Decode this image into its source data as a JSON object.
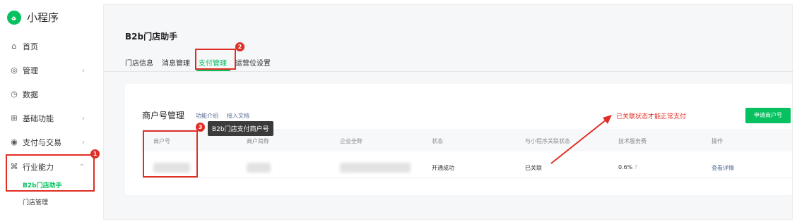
{
  "app": {
    "title": "小程序",
    "brand_color": "#07c160",
    "annotation_color": "#e02e24"
  },
  "sidebar": {
    "items": [
      {
        "label": "首页",
        "icon": "home-icon"
      },
      {
        "label": "管理",
        "icon": "settings-icon"
      },
      {
        "label": "数据",
        "icon": "clock-icon"
      },
      {
        "label": "基础功能",
        "icon": "grid-icon"
      },
      {
        "label": "支付与交易",
        "icon": "payment-icon"
      },
      {
        "label": "行业能力",
        "icon": "industry-icon"
      }
    ],
    "sub_items": [
      {
        "label": "B2b门店助手",
        "active": true
      },
      {
        "label": "门店管理",
        "active": false
      }
    ]
  },
  "main": {
    "page_title": "B2b门店助手",
    "tabs": [
      {
        "label": "门店信息"
      },
      {
        "label": "消息管理"
      },
      {
        "label": "支付管理",
        "active": true
      },
      {
        "label": "运营位设置"
      }
    ]
  },
  "card": {
    "title": "商户号管理",
    "link_intro": "功能介绍",
    "link_doc": "接入文档",
    "apply_button": "申请商户号",
    "columns": [
      "商户号",
      "商户简称",
      "企业全称",
      "状态",
      "与小程序关联状态",
      "技术服务费",
      "操作"
    ],
    "rows": [
      {
        "status": "开通成功",
        "link_status": "已关联",
        "fee": "0.6%",
        "help_mark": "?",
        "action": "查看详情"
      }
    ]
  },
  "annotations": {
    "badges": [
      "1",
      "2",
      "3"
    ],
    "tooltip": "B2b门店支付商户号",
    "note": "已关联状态才能正常支付"
  }
}
